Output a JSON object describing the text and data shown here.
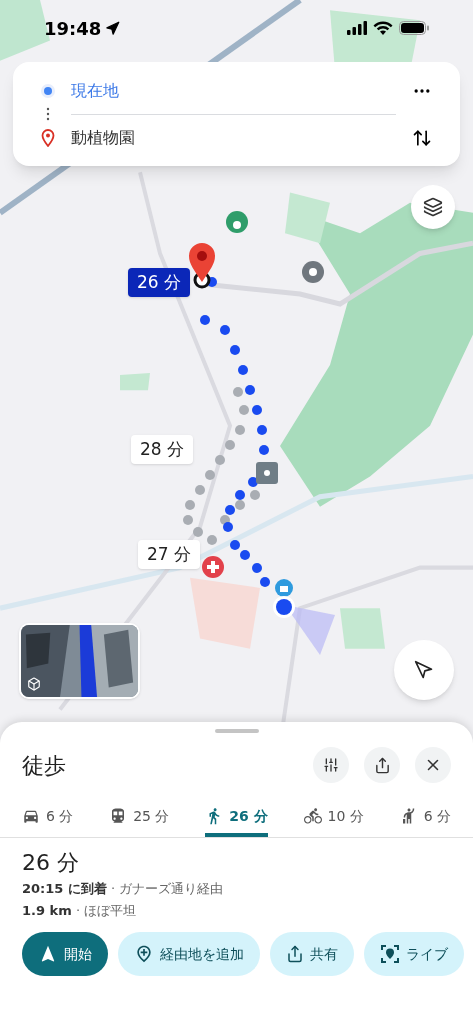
{
  "status_bar": {
    "time": "19:48"
  },
  "directions_card": {
    "origin": "現在地",
    "destination": "動植物園"
  },
  "route_labels": [
    {
      "text": "26 分",
      "selected": true
    },
    {
      "text": "28 分",
      "selected": false
    },
    {
      "text": "27 分",
      "selected": false
    }
  ],
  "sheet": {
    "title": "徒歩",
    "modes": [
      {
        "kind": "car",
        "label": "6 分",
        "selected": false
      },
      {
        "kind": "transit",
        "label": "25 分",
        "selected": false
      },
      {
        "kind": "walk",
        "label": "26 分",
        "selected": true
      },
      {
        "kind": "bike",
        "label": "10 分",
        "selected": false
      },
      {
        "kind": "ride",
        "label": "6 分",
        "selected": false
      }
    ],
    "duration": "26 分",
    "arrival": "**20:15 に到着** · ガナーズ通り経由",
    "distance": "**1.9 km** · ほぼ平坦",
    "actions": [
      {
        "kind": "start",
        "label": "開始"
      },
      {
        "kind": "waypoint",
        "label": "経由地を追加"
      },
      {
        "kind": "share",
        "label": "共有"
      },
      {
        "kind": "live",
        "label": "ライブ"
      }
    ]
  }
}
